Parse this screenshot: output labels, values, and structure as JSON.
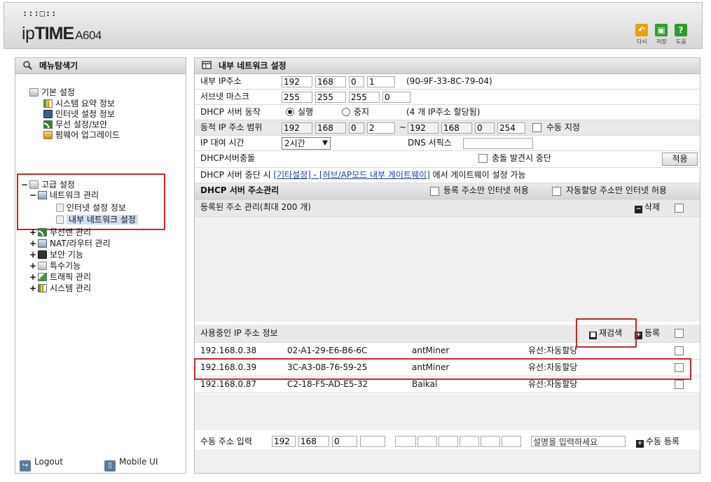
{
  "header": {
    "logo_mark": ":::□::",
    "logo_brand_a": "ip",
    "logo_brand_b": "TIME",
    "logo_model": "A604",
    "buttons": [
      {
        "label": "다시",
        "icon": "refresh-icon",
        "color": "#e3a20c"
      },
      {
        "label": "저장",
        "icon": "save-icon",
        "color": "#2f9b2f"
      },
      {
        "label": "도움",
        "icon": "help-icon",
        "color": "#2f9b2f"
      }
    ]
  },
  "sidebar": {
    "title": "메뉴탐색기",
    "basic_group": "기본 설정",
    "basic_items": [
      "시스템 요약 정보",
      "인터넷 설정 정보",
      "무선 설정/보안",
      "펌웨어 업그레이드"
    ],
    "advanced_group": "고급 설정",
    "network_group": "네트워크 관리",
    "network_items": [
      "인터넷 설정 정보",
      "내부 네트워크 설정"
    ],
    "other_groups": [
      "무선랜 관리",
      "NAT/라우터 관리",
      "보안 기능",
      "특수기능",
      "트래픽 관리",
      "시스템 관리"
    ],
    "footer_logout": "Logout",
    "footer_mobile": "Mobile UI"
  },
  "main": {
    "title": "내부 네트워크 설정",
    "internal_ip_label": "내부 IP주소",
    "internal_ip": [
      "192",
      "168",
      "0",
      "1"
    ],
    "mac": "(90-9F-33-8C-79-04)",
    "subnet_label": "서브넷 마스크",
    "subnet": [
      "255",
      "255",
      "255",
      "0"
    ],
    "dhcp_label": "DHCP 서버 동작",
    "dhcp_on": "실행",
    "dhcp_off": "중지",
    "dhcp_note": "(4 개 IP주소 할당됨)",
    "range_label": "동적 IP 주소 범위",
    "range_start": [
      "192",
      "168",
      "0",
      "2"
    ],
    "range_tilde": "~",
    "range_end": [
      "192",
      "168",
      "0",
      "254"
    ],
    "manual_assign": "수동 지정",
    "lease_label": "IP 대여 시간",
    "lease_value": "2시간",
    "dns_suffix_label": "DNS 서픽스",
    "dhcp_conflict_label": "DHCP서버충돌",
    "conflict_stop": "충돌 발견시 중단",
    "apply": "적용",
    "notice_pre": "DHCP 서버 중단 시 ",
    "notice_link": "[기타설정] - [허브/AP모드 내부 게이트웨이]",
    "notice_post": " 에서 게이트웨이 설정 가능",
    "addr_mgmt_title": "DHCP 서버 주소관리",
    "allow_registered": "등록 주소만 인터넷 허용",
    "allow_auto": "자동할당 주소만 인터넷 허용",
    "registered_title": "등록된 주소 관리(최대 200 개)",
    "delete": "삭제",
    "in_use_title": "사용중인 IP 주소 정보",
    "rescan": "재검색",
    "register": "등록",
    "clients": [
      {
        "ip": "192.168.0.38",
        "mac": "02-A1-29-E6-B6-6C",
        "name": "antMiner",
        "type": "유선:자동할당"
      },
      {
        "ip": "192.168.0.39",
        "mac": "3C-A3-08-76-59-25",
        "name": "antMiner",
        "type": "유선:자동할당"
      },
      {
        "ip": "192.168.0.87",
        "mac": "C2-18-F5-AD-E5-32",
        "name": "Baikal",
        "type": "유선:자동할당"
      }
    ],
    "manual_input_label": "수동 주소 입력",
    "manual_ip": [
      "192",
      "168",
      "0",
      ""
    ],
    "desc_placeholder": "설명을 입력하세요",
    "manual_register": "수동 등록"
  }
}
